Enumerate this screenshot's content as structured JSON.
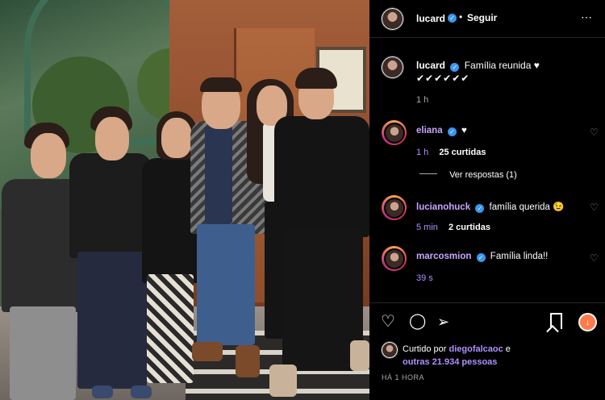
{
  "header": {
    "username": "lucard",
    "separator": "•",
    "follow_label": "Seguir",
    "more_icon": "⋯"
  },
  "caption": {
    "username": "lucard",
    "text": "Família reunida",
    "emoji_line": "✔✔✔✔✔✔",
    "heart": "♥",
    "time": "1 h"
  },
  "comments": [
    {
      "username": "eliana",
      "text": "♥",
      "time": "1 h",
      "likes": "25 curtidas"
    },
    {
      "username": "lucianohuck",
      "text": "família querida 😉",
      "time": "5 min",
      "likes": "2 curtidas"
    },
    {
      "username": "marcosmion",
      "text": "Família linda!!",
      "time": "39 s",
      "likes": ""
    }
  ],
  "replies_label": "Ver respostas (1)",
  "likes": {
    "prefix": "Curtido por",
    "user": "diegofalcaoc",
    "conj": "e",
    "others": "outras 21.934 pessoas"
  },
  "post_time": "HÁ 1 HORA",
  "colors": {
    "verified": "#3897f0",
    "link": "#b08fff",
    "background": "#000000",
    "badge": "#ff7a4a"
  },
  "icons": [
    "heart-icon",
    "comment-icon",
    "share-icon",
    "bookmark-icon",
    "verified-icon",
    "more-icon",
    "emoji-badge-icon"
  ]
}
